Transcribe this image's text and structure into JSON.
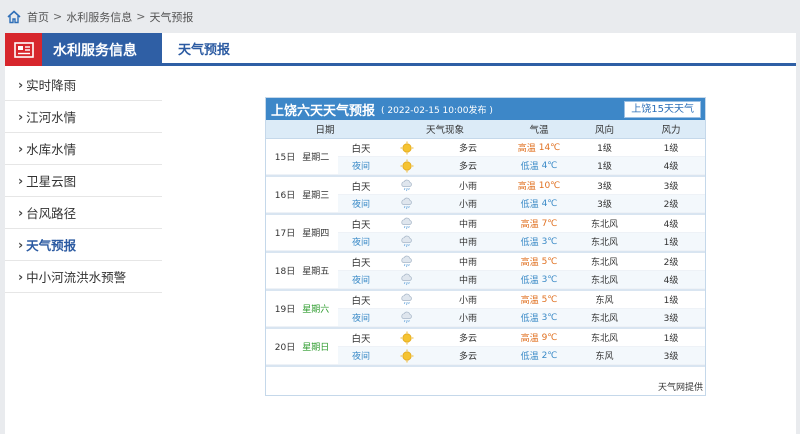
{
  "breadcrumb": {
    "items": [
      "首页",
      "水利服务信息",
      "天气预报"
    ]
  },
  "sidebar": {
    "title": "水利服务信息",
    "items": [
      {
        "label": "实时降雨"
      },
      {
        "label": "江河水情"
      },
      {
        "label": "水库水情"
      },
      {
        "label": "卫星云图"
      },
      {
        "label": "台风路径"
      },
      {
        "label": "天气预报"
      },
      {
        "label": "中小河流洪水预警"
      }
    ],
    "active_index": 5
  },
  "main": {
    "title": "天气预报"
  },
  "widget": {
    "title": "上饶六天天气预报",
    "published": "( 2022-02-15 10:00发布 )",
    "button": "上饶15天天气",
    "columns": [
      "日期",
      "天气现象",
      "气温",
      "风向",
      "风力"
    ],
    "day_label": "白天",
    "night_label": "夜间",
    "high_label": "高温",
    "low_label": "低温",
    "days": [
      {
        "date": "15日",
        "weekday": "星期二",
        "weekend": false,
        "day": {
          "icon": "sun-icon",
          "weather": "多云",
          "temp": "14℃",
          "wind_dir": "1级",
          "wind_force": "1级"
        },
        "night": {
          "icon": "sun-icon",
          "weather": "多云",
          "temp": "4℃",
          "wind_dir": "1级",
          "wind_force": "4级"
        }
      },
      {
        "date": "16日",
        "weekday": "星期三",
        "weekend": false,
        "day": {
          "icon": "rain-icon",
          "weather": "小雨",
          "temp": "10℃",
          "wind_dir": "3级",
          "wind_force": "3级"
        },
        "night": {
          "icon": "rain-icon",
          "weather": "小雨",
          "temp": "4℃",
          "wind_dir": "3级",
          "wind_force": "2级"
        }
      },
      {
        "date": "17日",
        "weekday": "星期四",
        "weekend": false,
        "day": {
          "icon": "rain-icon",
          "weather": "中雨",
          "temp": "7℃",
          "wind_dir": "东北风",
          "wind_force": "4级"
        },
        "night": {
          "icon": "rain-icon",
          "weather": "中雨",
          "temp": "3℃",
          "wind_dir": "东北风",
          "wind_force": "1级"
        }
      },
      {
        "date": "18日",
        "weekday": "星期五",
        "weekend": false,
        "day": {
          "icon": "rain-icon",
          "weather": "中雨",
          "temp": "5℃",
          "wind_dir": "东北风",
          "wind_force": "2级"
        },
        "night": {
          "icon": "rain-icon",
          "weather": "中雨",
          "temp": "3℃",
          "wind_dir": "东北风",
          "wind_force": "4级"
        }
      },
      {
        "date": "19日",
        "weekday": "星期六",
        "weekend": true,
        "day": {
          "icon": "rain-icon",
          "weather": "小雨",
          "temp": "5℃",
          "wind_dir": "东风",
          "wind_force": "1级"
        },
        "night": {
          "icon": "rain-icon",
          "weather": "小雨",
          "temp": "3℃",
          "wind_dir": "东北风",
          "wind_force": "3级"
        }
      },
      {
        "date": "20日",
        "weekday": "星期日",
        "weekend": true,
        "day": {
          "icon": "sun-icon",
          "weather": "多云",
          "temp": "9℃",
          "wind_dir": "东北风",
          "wind_force": "1级"
        },
        "night": {
          "icon": "sun-icon",
          "weather": "多云",
          "temp": "2℃",
          "wind_dir": "东风",
          "wind_force": "3级"
        }
      }
    ],
    "source": "天气网提供"
  }
}
